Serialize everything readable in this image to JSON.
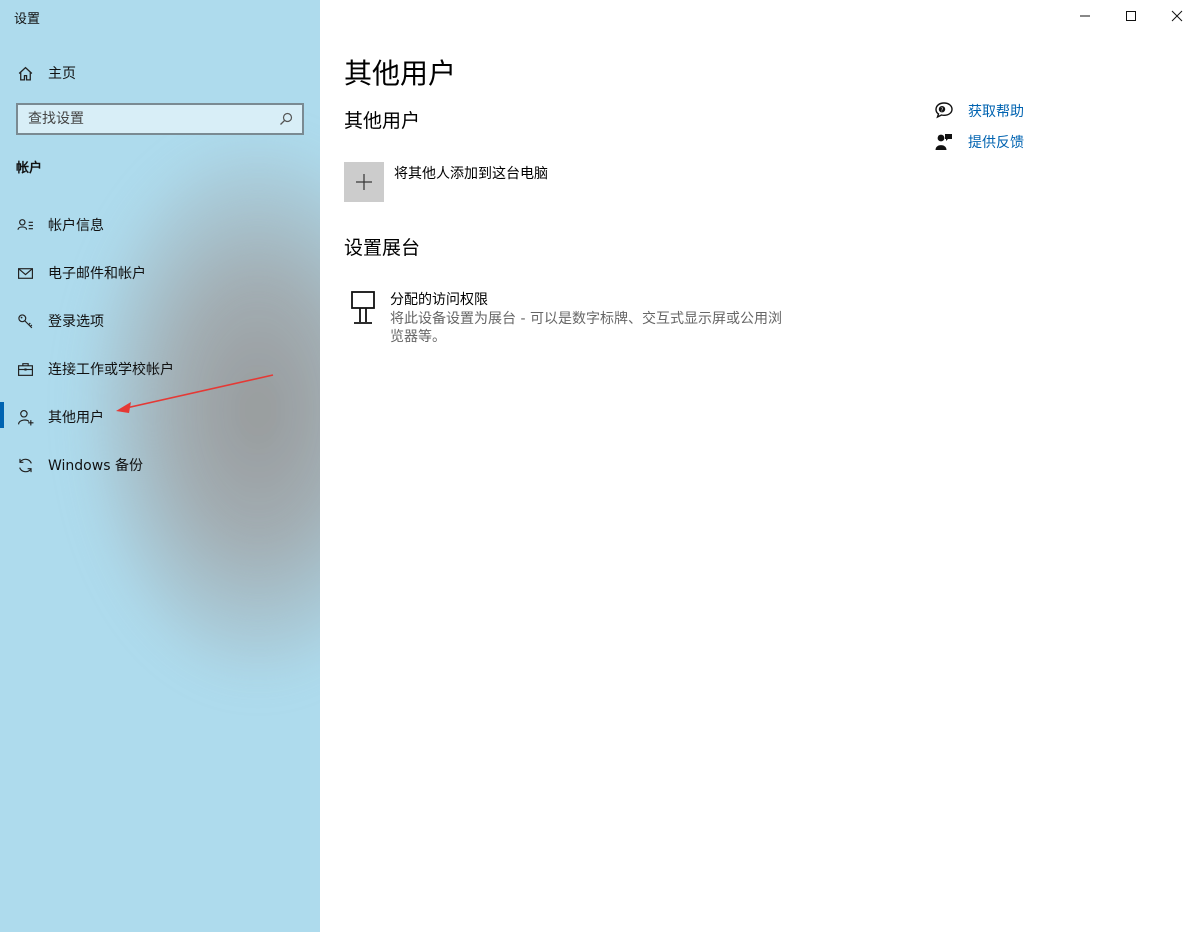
{
  "window": {
    "title": "设置",
    "controls": [
      "minimize-icon",
      "maximize-icon",
      "close-icon"
    ]
  },
  "sidebar": {
    "home_label": "主页",
    "search_placeholder": "查找设置",
    "section_label": "帐户",
    "items": [
      {
        "label": "帐户信息",
        "icon": "account-info-icon"
      },
      {
        "label": "电子邮件和帐户",
        "icon": "mail-icon"
      },
      {
        "label": "登录选项",
        "icon": "key-icon"
      },
      {
        "label": "连接工作或学校帐户",
        "icon": "briefcase-icon"
      },
      {
        "label": "其他用户",
        "icon": "add-person-icon",
        "active": true
      },
      {
        "label": "Windows 备份",
        "icon": "sync-icon"
      }
    ],
    "accent_color": "#0063b1",
    "annotation_arrow_color": "#e53935"
  },
  "main": {
    "page_title": "其他用户",
    "other_users": {
      "heading": "其他用户",
      "add_label": "将其他人添加到这台电脑"
    },
    "kiosk": {
      "heading": "设置展台",
      "item_title": "分配的访问权限",
      "item_desc": "将此设备设置为展台 - 可以是数字标牌、交互式显示屏或公用浏览器等。"
    },
    "help_links": {
      "get_help": "获取帮助",
      "feedback": "提供反馈"
    }
  }
}
